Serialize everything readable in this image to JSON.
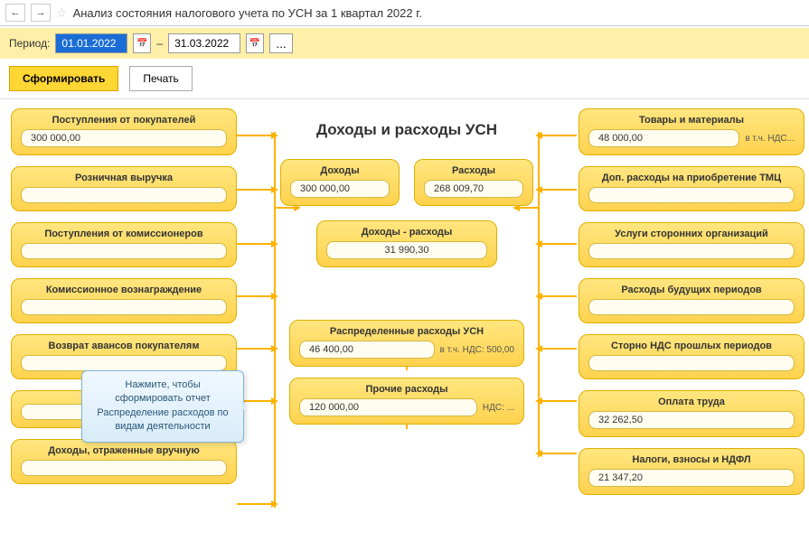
{
  "header": {
    "title": "Анализ состояния налогового учета по УСН за 1 квартал 2022 г."
  },
  "period": {
    "label": "Период:",
    "from": "01.01.2022",
    "dash": "–",
    "to": "31.03.2022"
  },
  "toolbar": {
    "generate": "Сформировать",
    "print": "Печать"
  },
  "diagram": {
    "title": "Доходы и расходы УСН",
    "left": [
      {
        "title": "Поступления от покупателей",
        "value": "300 000,00"
      },
      {
        "title": "Розничная выручка",
        "value": ""
      },
      {
        "title": "Поступления от комиссионеров",
        "value": ""
      },
      {
        "title": "Комиссионное вознаграждение",
        "value": ""
      },
      {
        "title": "Возврат авансов покупателям",
        "value": ""
      },
      {
        "title": "",
        "value": ""
      },
      {
        "title": "Доходы, отраженные вручную",
        "value": ""
      }
    ],
    "center": {
      "income": {
        "title": "Доходы",
        "value": "300 000,00"
      },
      "expense": {
        "title": "Расходы",
        "value": "268 009,70"
      },
      "diff": {
        "title": "Доходы - расходы",
        "value": "31 990,30"
      },
      "distributed": {
        "title": "Распределенные расходы УСН",
        "value": "46 400,00",
        "note": "в т.ч. НДС: 500,00"
      },
      "other": {
        "title": "Прочие расходы",
        "value": "120 000,00",
        "note": "НДС: ..."
      }
    },
    "right": [
      {
        "title": "Товары и материалы",
        "value": "48 000,00",
        "note": "в т.ч. НДС..."
      },
      {
        "title": "Доп. расходы на приобретение ТМЦ",
        "value": ""
      },
      {
        "title": "Услуги сторонних организаций",
        "value": ""
      },
      {
        "title": "Расходы будущих периодов",
        "value": ""
      },
      {
        "title": "Сторно НДС прошлых периодов",
        "value": ""
      },
      {
        "title": "Оплата труда",
        "value": "32 262,50"
      },
      {
        "title": "Налоги, взносы и НДФЛ",
        "value": "21 347,20"
      }
    ]
  },
  "tooltip": {
    "text": "Нажмите, чтобы сформировать отчет Распределение расходов по видам деятельности"
  }
}
